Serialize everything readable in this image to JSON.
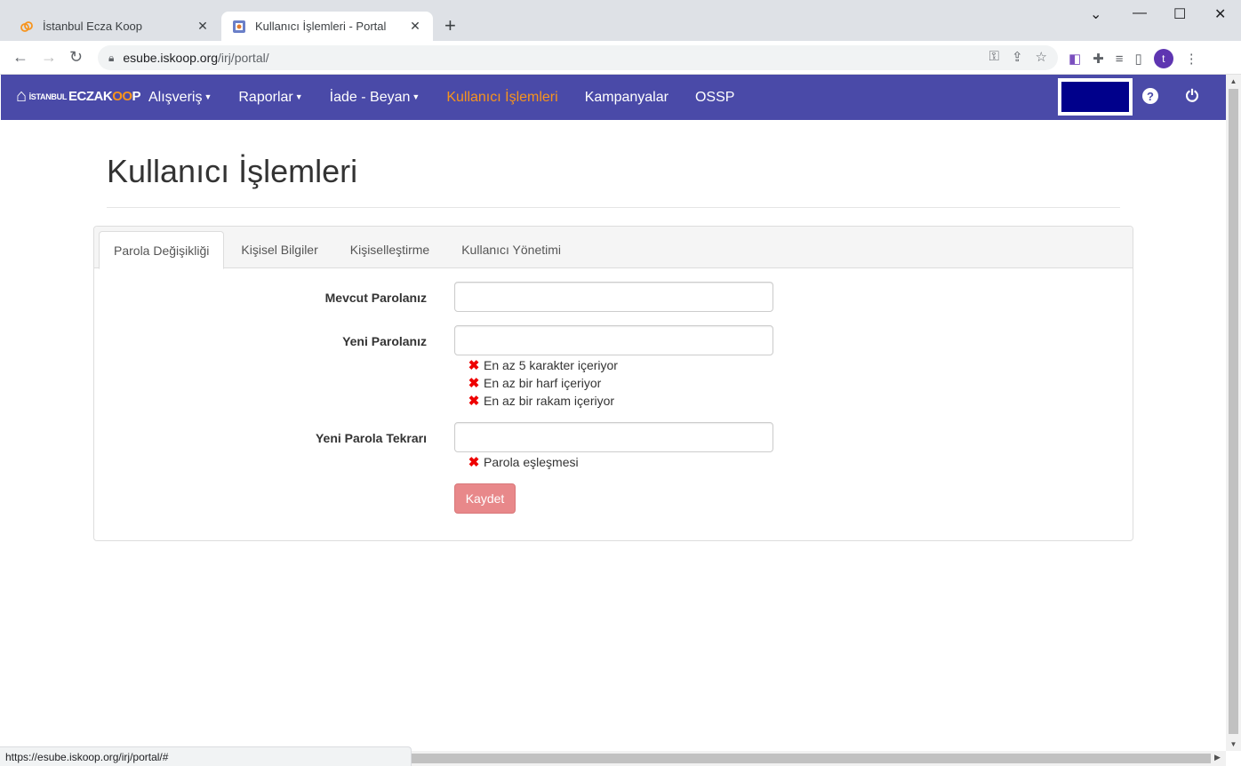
{
  "browser": {
    "tabs": [
      {
        "title": "İstanbul Ecza Koop"
      },
      {
        "title": "Kullanıcı İşlemleri - Portal"
      }
    ],
    "url_host": "esube.iskoop.org",
    "url_path": "/irj/portal/",
    "status_url": "https://esube.iskoop.org/irj/portal/#",
    "avatar_letter": "t",
    "icons": [
      "back-icon",
      "forward-icon",
      "reload-icon",
      "lock-icon",
      "key-icon",
      "share-icon",
      "star-icon",
      "extension-icon",
      "media-icon",
      "sidepanel-icon",
      "menu-icon"
    ]
  },
  "navbar": {
    "brand_small": "İSTANBUL",
    "brand_main": "ECZAK",
    "brand_oo": "OO",
    "brand_end": "P",
    "items": [
      {
        "label": "Alışveriş",
        "dropdown": true
      },
      {
        "label": "Raporlar",
        "dropdown": true
      },
      {
        "label": "İade - Beyan",
        "dropdown": true
      },
      {
        "label": "Kullanıcı İşlemleri",
        "active": true
      },
      {
        "label": "Kampanyalar"
      },
      {
        "label": "OSSP"
      }
    ],
    "help_glyph": "?",
    "colors": {
      "bar": "#4a4aa8",
      "active": "#f7941d",
      "box": "#00008b"
    }
  },
  "page": {
    "title": "Kullanıcı İşlemleri",
    "tabs": [
      {
        "label": "Parola Değişikliği",
        "active": true
      },
      {
        "label": "Kişisel Bilgiler"
      },
      {
        "label": "Kişiselleştirme"
      },
      {
        "label": "Kullanıcı Yönetimi"
      }
    ],
    "form": {
      "current_label": "Mevcut Parolanız",
      "new_label": "Yeni Parolanız",
      "repeat_label": "Yeni Parola Tekrarı",
      "new_rules": [
        "En az 5 karakter içeriyor",
        "En az bir harf içeriyor",
        "En az bir rakam içeriyor"
      ],
      "repeat_rules": [
        "Parola eşleşmesi"
      ],
      "save_label": "Kaydet"
    }
  }
}
